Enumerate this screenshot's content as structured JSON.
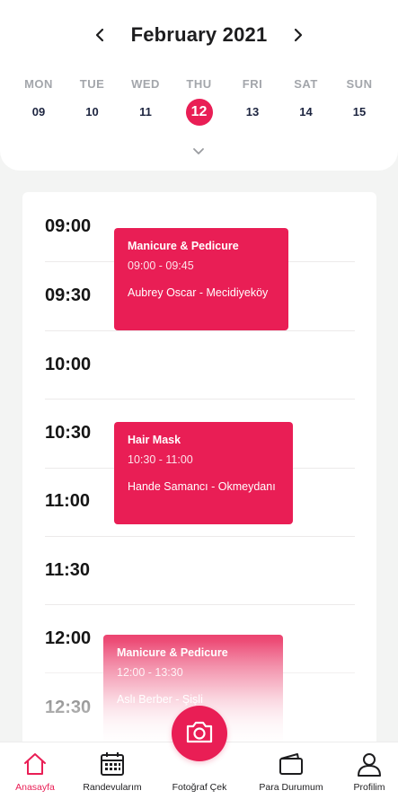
{
  "header": {
    "month_title": "February 2021",
    "week": [
      {
        "name": "MON",
        "num": "09"
      },
      {
        "name": "TUE",
        "num": "10"
      },
      {
        "name": "WED",
        "num": "11"
      },
      {
        "name": "THU",
        "num": "12"
      },
      {
        "name": "FRI",
        "num": "13"
      },
      {
        "name": "SAT",
        "num": "14"
      },
      {
        "name": "SUN",
        "num": "15"
      }
    ],
    "selected_day": "12"
  },
  "schedule": {
    "slots": [
      "09:00",
      "09:30",
      "10:00",
      "10:30",
      "11:00",
      "11:30",
      "12:00",
      "12:30"
    ],
    "events": [
      {
        "title": "Manicure & Pedicure",
        "time": "09:00 - 09:45",
        "client": "Aubrey Oscar - Mecidiyeköy"
      },
      {
        "title": "Hair Mask",
        "time": "10:30 - 11:00",
        "client": "Hande Samancı - Okmeydanı"
      },
      {
        "title": "Manicure & Pedicure",
        "time": "12:00 - 13:30",
        "client": "Aslı Berber - Şişli"
      }
    ]
  },
  "nav": {
    "home": "Anasayfa",
    "appointments": "Randevularım",
    "camera": "Fotoğraf Çek",
    "money": "Para Durumum",
    "profile": "Profilim"
  },
  "colors": {
    "accent": "#e91e55",
    "text": "#1d1d1f",
    "muted": "#a3a6ab",
    "background": "#f3f4f3"
  },
  "icons": {
    "prev": "chevron-left-icon",
    "next": "chevron-right-icon",
    "expand": "chevron-down-icon",
    "home": "home-icon",
    "appointments": "calendar-icon",
    "camera": "camera-icon",
    "money": "wallet-icon",
    "profile": "user-icon"
  }
}
